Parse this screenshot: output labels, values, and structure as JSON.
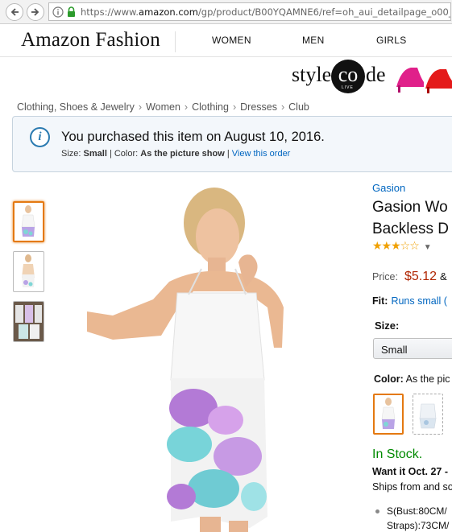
{
  "browser": {
    "url_prefix": "https://www.",
    "url_domain": "amazon.com",
    "url_rest": "/gp/product/B00YQAMNE6/ref=oh_aui_detailpage_o00_s00"
  },
  "header": {
    "brand": "Amazon Fashion",
    "nav": [
      "WOMEN",
      "MEN",
      "GIRLS"
    ]
  },
  "banner": {
    "text_left": "style",
    "text_circle": "co",
    "text_right": "de",
    "live": "LIVE"
  },
  "breadcrumb": [
    "Clothing, Shoes & Jewelry",
    "Women",
    "Clothing",
    "Dresses",
    "Club"
  ],
  "breadcrumb_sep": "›",
  "purchase": {
    "title": "You purchased this item on August 10, 2016.",
    "size_label": "Size:",
    "size_value": "Small",
    "color_label": "| Color:",
    "color_value": "As the picture show",
    "pipe": "|",
    "view_link": "View this order"
  },
  "product": {
    "brand": "Gasion",
    "title_line1": "Gasion Wo",
    "title_line2": "Backless D",
    "rating": 3.5,
    "stars_text": "★★★☆☆",
    "price_label": "Price:",
    "price": "$5.12",
    "price_amp": "&",
    "fit_label": "Fit:",
    "fit_value": "Runs small (",
    "size_label": "Size:",
    "size_selected": "Small",
    "color_label": "Color:",
    "color_value": "As the pic",
    "stock": "In Stock.",
    "want_it": "Want it Oct. 27 -",
    "ships": "Ships from and so",
    "bullet_line1": "S(Bust:80CM/",
    "bullet_line2": "Straps):73CM/"
  },
  "colors": {
    "accent_orange": "#e47911",
    "link_blue": "#0066c0",
    "price_red": "#b12704",
    "stock_green": "#008a00"
  }
}
